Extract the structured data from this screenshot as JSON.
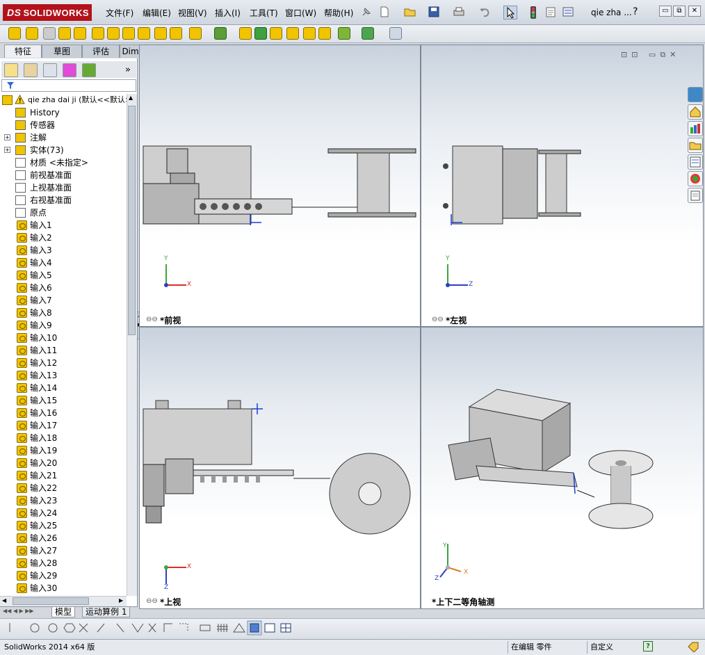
{
  "app": {
    "logo_text": "SOLIDWORKS",
    "doc_title": "qie zha ..."
  },
  "menu": [
    {
      "label": "文件(F)"
    },
    {
      "label": "编辑(E)"
    },
    {
      "label": "视图(V)"
    },
    {
      "label": "插入(I)"
    },
    {
      "label": "工具(T)"
    },
    {
      "label": "窗口(W)"
    },
    {
      "label": "帮助(H)"
    }
  ],
  "window_controls": {
    "help": "?",
    "minimize": "▭",
    "restore": "⧉",
    "close": "✕"
  },
  "feature_tabs": [
    {
      "label": "特征",
      "selected": true
    },
    {
      "label": "草图",
      "selected": false
    },
    {
      "label": "评估",
      "selected": false
    },
    {
      "label": "DimXpert",
      "selected": false
    }
  ],
  "tree": {
    "root": "qie zha dai ji  (默认<<默认>",
    "items": [
      {
        "label": "History",
        "icon": "history-icon",
        "expand": ""
      },
      {
        "label": "传感器",
        "icon": "sensor-icon",
        "expand": ""
      },
      {
        "label": "注解",
        "icon": "annotation-icon",
        "expand": "+"
      },
      {
        "label": "实体(73)",
        "icon": "solid-bodies-icon",
        "expand": "+"
      },
      {
        "label": "材质 <未指定>",
        "icon": "material-icon",
        "expand": ""
      },
      {
        "label": "前视基准面",
        "icon": "plane-icon",
        "expand": ""
      },
      {
        "label": "上视基准面",
        "icon": "plane-icon",
        "expand": ""
      },
      {
        "label": "右视基准面",
        "icon": "plane-icon",
        "expand": ""
      },
      {
        "label": "原点",
        "icon": "origin-icon",
        "expand": ""
      }
    ],
    "features": [
      "输入1",
      "输入2",
      "输入3",
      "输入4",
      "输入5",
      "输入6",
      "输入7",
      "输入8",
      "输入9",
      "输入10",
      "输入11",
      "输入12",
      "输入13",
      "输入14",
      "输入15",
      "输入16",
      "输入17",
      "输入18",
      "输入19",
      "输入20",
      "输入21",
      "输入22",
      "输入23",
      "输入24",
      "输入25",
      "输入26",
      "输入27",
      "输入28",
      "输入29",
      "输入30"
    ]
  },
  "bottom_tabs": {
    "model": "模型",
    "motion": "运动算例 1"
  },
  "viewports": {
    "front": "*前视",
    "left": "*左视",
    "top": "*上视",
    "iso": "*上下二等角轴测"
  },
  "axes": {
    "x": "X",
    "y": "Y",
    "z": "Z"
  },
  "status": {
    "app": "SolidWorks 2014 x64 版",
    "editing": "在编辑 零件",
    "units": "自定义",
    "help": "?"
  }
}
